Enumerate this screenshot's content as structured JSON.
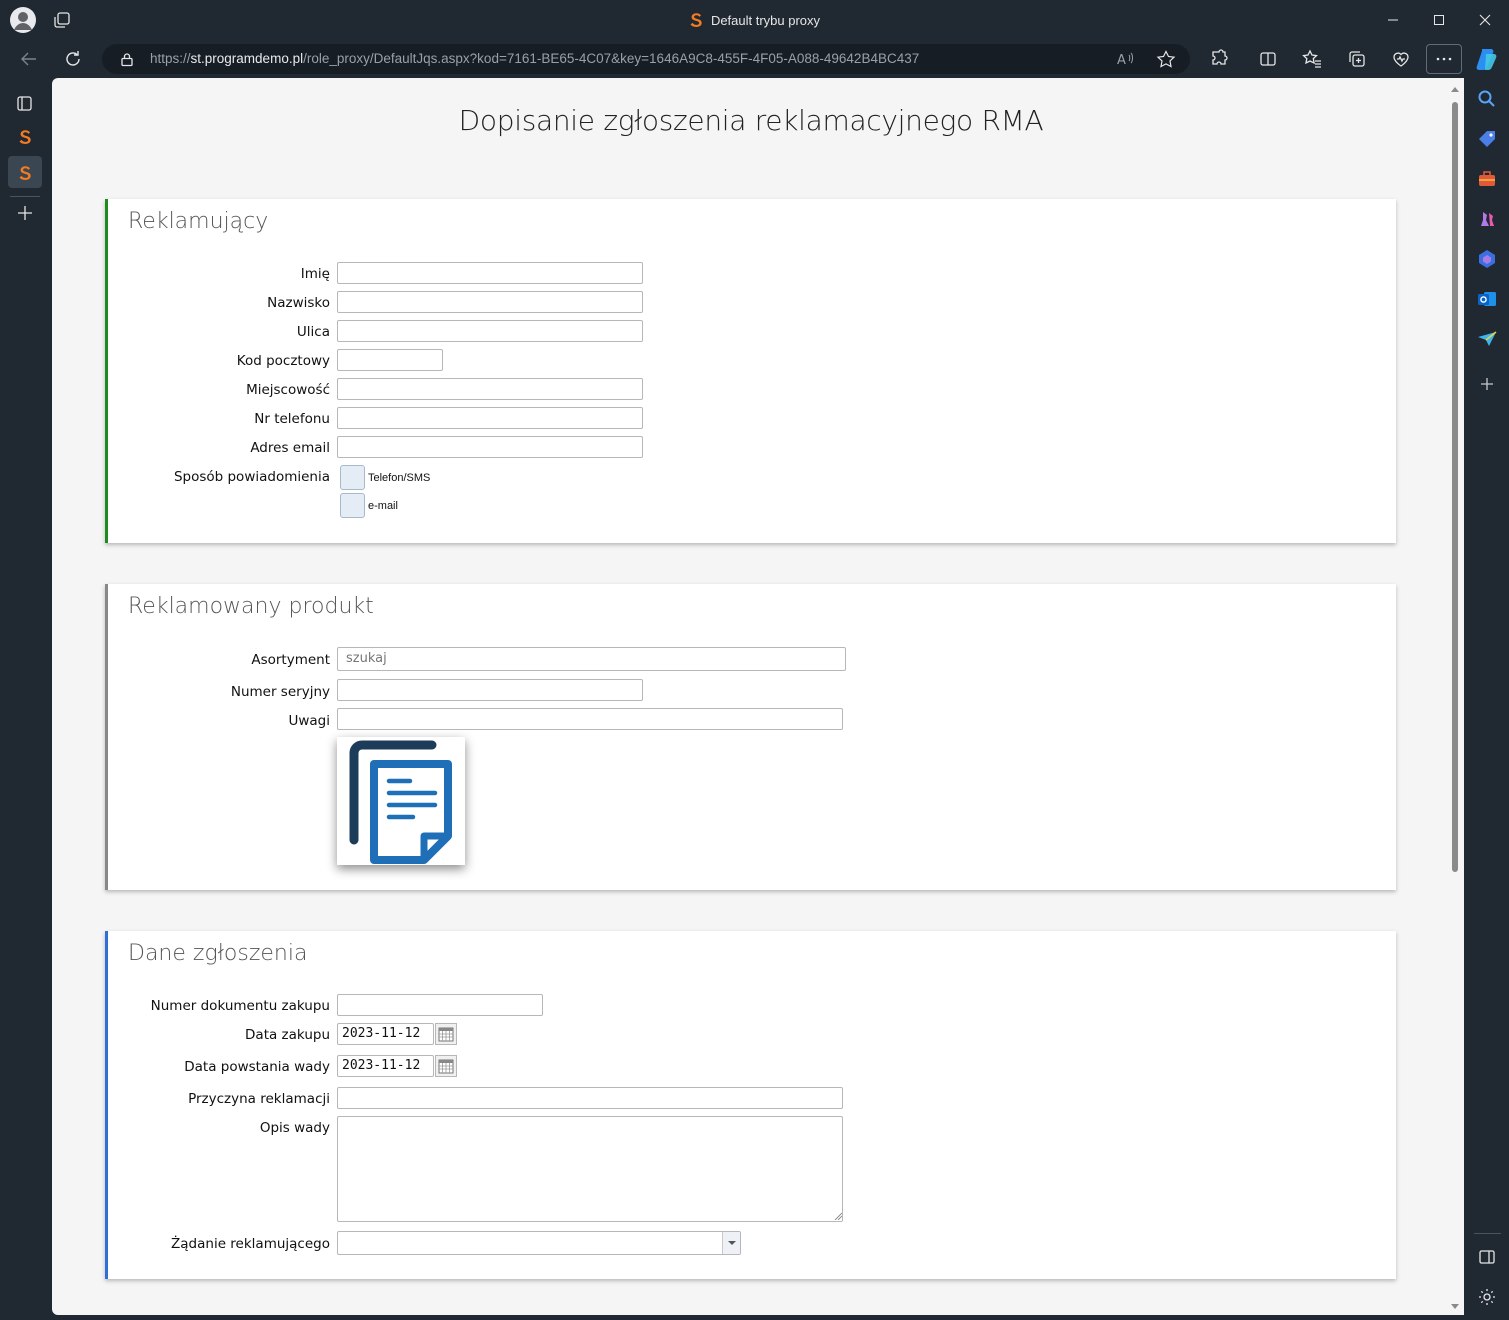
{
  "browser": {
    "window_title": "Default trybu proxy",
    "url_scheme": "https://",
    "url_host": "st.programdemo.pl",
    "url_path": "/role_proxy/DefaultJqs.aspx?kod=7161-BE65-4C07&key=1646A9C8-455F-4F05-A088-49642B4BC437",
    "accent": "#f47b20"
  },
  "page": {
    "title": "Dopisanie zgłoszenia reklamacyjnego RMA"
  },
  "sections": {
    "reklamujacy": {
      "title": "Reklamujący",
      "stripe_color": "#1f8a1f",
      "fields": {
        "imie": {
          "label": "Imię",
          "value": ""
        },
        "nazwisko": {
          "label": "Nazwisko",
          "value": ""
        },
        "ulica": {
          "label": "Ulica",
          "value": ""
        },
        "kod": {
          "label": "Kod pocztowy",
          "value": ""
        },
        "miejscowosc": {
          "label": "Miejscowość",
          "value": ""
        },
        "telefon": {
          "label": "Nr telefonu",
          "value": ""
        },
        "email": {
          "label": "Adres email",
          "value": ""
        },
        "powiadomienie": {
          "label": "Sposób powiadomienia",
          "options": [
            "Telefon/SMS",
            "e-mail"
          ]
        }
      }
    },
    "produkt": {
      "title": "Reklamowany produkt",
      "stripe_color": "#888888",
      "fields": {
        "asortyment": {
          "label": "Asortyment",
          "placeholder": "szukaj"
        },
        "numer_seryjny": {
          "label": "Numer seryjny",
          "value": ""
        },
        "uwagi": {
          "label": "Uwagi",
          "value": ""
        }
      },
      "attachment_icon": "document-icon"
    },
    "zgloszenie": {
      "title": "Dane zgłoszenia",
      "stripe_color": "#2f6fd6",
      "fields": {
        "numer_dokumentu": {
          "label": "Numer dokumentu zakupu",
          "value": ""
        },
        "data_zakupu": {
          "label": "Data zakupu",
          "value": "2023-11-12"
        },
        "data_wady": {
          "label": "Data powstania wady",
          "value": "2023-11-12"
        },
        "przyczyna": {
          "label": "Przyczyna reklamacji",
          "value": ""
        },
        "opis": {
          "label": "Opis wady",
          "value": ""
        },
        "zadanie": {
          "label": "Żądanie reklamującego",
          "value": ""
        }
      }
    }
  }
}
